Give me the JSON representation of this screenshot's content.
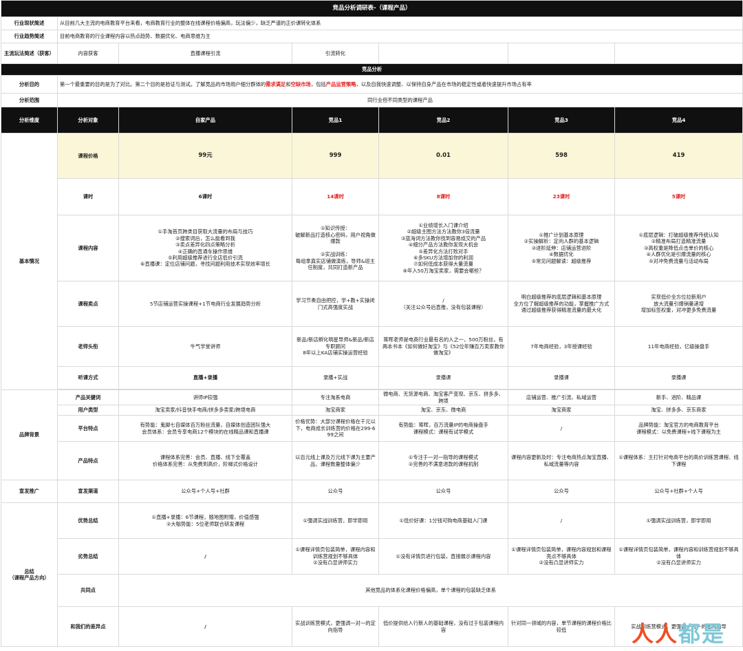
{
  "title": "竞品分析调研表-（课程产品）",
  "overview": {
    "row1": {
      "label": "行业现状简述",
      "text": "从目前几大主流的电商教育平台来看，电商教育行业的整体在线课程价格偏高，玩法偏少，缺乏严谨的正价课转化体系"
    },
    "row2": {
      "label": "行业趋势简述",
      "text": "目前电商教育的行业课程内容以热点趋势、数据优化、电商思维为主"
    },
    "row3": {
      "label": "主流玩法简述（获客）",
      "c1": "内容获客",
      "c2": "直播课程引流",
      "c3": "引流转化"
    }
  },
  "section_title": "竞品分析",
  "purpose": {
    "label": "分析目的",
    "t1": "第一个最重要的目的是为了对比。第二个目的是验证与测试。了解竞品的市场用户细分群体的",
    "h1": "需求满足",
    "t2": "和",
    "h2": "空缺市场",
    "t3": "，包括",
    "h3": "产品运营策略",
    "t4": "，以及自我快速调整、以保持自身产品在市场的稳定性或者快速提升市场占有率"
  },
  "scope": {
    "label": "分析范围",
    "text": "同行业但不同类型的课程产品"
  },
  "header": {
    "dim": "分析维度",
    "obj": "分析对象",
    "cols": [
      "自家产品",
      "竞品1",
      "竞品2",
      "竞品3",
      "竞品4"
    ]
  },
  "groups": {
    "basic": "基本情况",
    "brand": "品牌背景",
    "promo": "宣发推广",
    "summary": "总结\n（课程产品方向）"
  },
  "rows": {
    "price": {
      "label": "课程价格",
      "v": [
        "99元",
        "999",
        "0.01",
        "598",
        "419"
      ]
    },
    "hours": {
      "label": "课时",
      "v": [
        "6课时",
        "14课时",
        "8课时",
        "23课时",
        "5课时"
      ]
    },
    "content": {
      "label": "课程内容",
      "v": [
        "①手淘首页跨类目获取大流量的布局与技巧\n②搜索词后，怎么能看到我\n③卖点差异化四点策略分析\n④正确的直通车操作思维\n⑤利用超级推荐进行全店低价引流\n⑥直播课：定位店铺问题，寻找问题利用技术实现效率增长",
        "①知识传授：\n破解新品打造核心密码，用户视角做爆款\n\n②实战训练：\n每组拿真实店铺做演练，导师&班主任制度，共同打造新产品",
        "①业绩增长入门课介绍\n②超级主图方法方法教你3倍流量\n③蓝海词方法教你找到容易成交的产品\n④细分产品方法教你发现大机会\n⑤差异化方法打败对手\n⑥多SKU方法增加你的利润\n⑦如何低成本获得大量流量\n⑧年入50万淘宝卖家，需要会哪些？",
        "①推广计划基本原理\n②实操解析：定向人群的基本逻辑\n③进阶延伸：店铺运营进阶\n④数据优化\n⑤常见问题解读：超级推荐",
        "①底层逻辑：打破超级推荐传统认知\n②精准布局打造精准流量\n③高权重是降低点击单价的核心\n④人群优化是引爆流量的核心\n⑤对冲免费流量与活动布局"
      ]
    },
    "selling": {
      "label": "课程卖点",
      "v": [
        "5节店铺运营实操课程+1节电商行业发展趋势分析",
        "学习节奏自由把控，学+教+实操闭门式高强度实战",
        "/\n（关注公众号后直推，没有包装课程）",
        "明白超级推荐的底层逻辑和基本原理\n全方位了解超级推荐的功能，掌握推广方式\n通过超级推荐获得精准流量的最大化",
        "实现低价全方位拉新用户\n放大流量引爆销量递增\n增加标签权重，对冲更多免费流量"
      ]
    },
    "teacher": {
      "label": "老师头衔",
      "v": [
        "牛气学堂讲师",
        "新品/新店孵化明星导师&新品/新店专职顾问\n8年以上KA店铺实操运营经验",
        "蒋晖老师是电商行业最有名的人之一，500万粉丝，有两本书本《如何做好淘宝》与《52位年赚百万卖家教你做淘宝》",
        "7年电商经验，3年授课经验",
        "11年电商经验，亿级操盘手"
      ]
    },
    "mode": {
      "label": "听课方式",
      "v": [
        "直播+录播",
        "录播+实战",
        "录播课",
        "录播课",
        "录播课"
      ]
    },
    "keyword": {
      "label": "产品关键词",
      "v": [
        "讲师IP较强",
        "专注淘系电商",
        "微电商、无货源电商、淘宝客产变现、京东、拼多多、跨境",
        "店铺运营、推广引流、私域运营",
        "新手、进阶、精品课"
      ]
    },
    "users": {
      "label": "用户类型",
      "v": [
        "淘宝卖家/抖音快手电商/拼多多卖家/跨境电商",
        "淘宝商家",
        "淘宝、京东、微电商",
        "淘宝商家",
        "淘宝、拼多多、京东商家"
      ]
    },
    "platform": {
      "label": "平台特点",
      "v": [
        "有势能：鬼脚七自媒体百万粉丝流量，自媒体创造团队强大\n会员体系：会员专享电商12个模块的在线精品课和直播课",
        "价格优势：大部分课程价格在千元以下，电商成长训练营的价格在299-699之间",
        "有势能：蒋晖，百万流量IP的电商操盘手\n课程模式：课程有试学模式",
        "/",
        "品牌势能：淘宝官方的电商教育平台\n课程模式：以免费课程+线下课程为主"
      ]
    },
    "product": {
      "label": "产品特点",
      "v": [
        "课程体系完善：会员、直播、线下全覆盖\n价格体系完善：从免费到高价，阶梯式价格设计",
        "以百元线上课及万元线下课为主要产品，课程数量整体偏少",
        "①专注于一对一指导的课程模式\n②完善的不满意退款的课程机制",
        "课程内容更新及时：专注电商热点淘宝直播、私域流量等内容",
        "①课程体系：主打针对电商平台的高价训练营课程、线下课程"
      ]
    },
    "channel": {
      "label": "宣发渠道",
      "v": [
        "公众号+个人号+社群",
        "公众号",
        "公众号",
        "公众号",
        "公众号+社群+个人号"
      ]
    },
    "adv": {
      "label": "优势总结",
      "v": [
        "①直播+录播：6节课程，随地图附赠，价值感强\n②大咖势能：5位老师联合研发课程",
        "①强调实战训练营，即学即用",
        "①低价好课：1分钱可购电商基础入门课",
        "/",
        "①强调实战训练营，即学即用"
      ]
    },
    "dis": {
      "label": "劣势总结",
      "v": [
        "/",
        "①课程详情页包装简单，课程内容和训练营规划不够具体\n②没有凸显讲师实力",
        "①没有详情页进行包装，直接展示课程内容",
        "①课程详情页包装简单，课程内容规划和课程亮点不够具体\n②没有凸显讲师实力",
        "①课程详情页包装简单，课程内容和训练营规划不够具体\n②没有凸显讲师实力"
      ]
    },
    "common": {
      "label": "共同点",
      "text": "其他竞品的体系化课程价格偏高，单个课程的包装缺乏体系"
    },
    "diff": {
      "label": "和我们的差异点",
      "v": [
        "/",
        "实战训练营模式，更强调一对一的定向指导",
        "低价提供给入行新人的基础课程，没有过于包装课程内容",
        "针对同一领域的内容，单节课程的课程价格比较低",
        "实战训练营模式，更强调一对一的定向指导"
      ]
    }
  },
  "watermark": {
    "part1": "人人",
    "part2": "都是"
  }
}
